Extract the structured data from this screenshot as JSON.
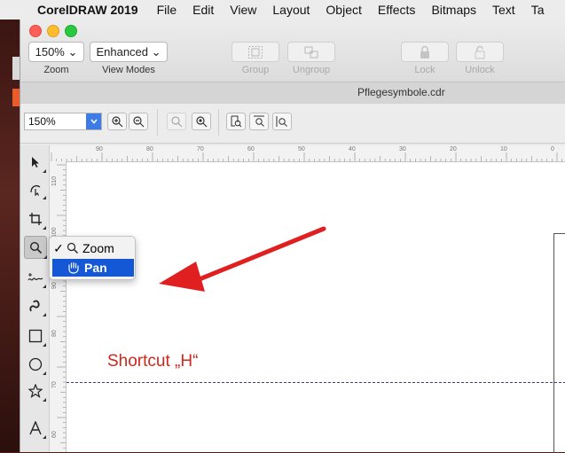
{
  "menubar": {
    "app_name": "CorelDRAW 2019",
    "items": [
      "File",
      "Edit",
      "View",
      "Layout",
      "Object",
      "Effects",
      "Bitmaps",
      "Text",
      "Ta"
    ]
  },
  "toolbar": {
    "zoom_value": "150% ⌄",
    "zoom_label": "Zoom",
    "view_mode_value": "Enhanced ⌄",
    "view_mode_label": "View Modes",
    "group_label": "Group",
    "ungroup_label": "Ungroup",
    "lock_label": "Lock",
    "unlock_label": "Unlock"
  },
  "document": {
    "filename": "Pflegesymbole.cdr"
  },
  "property_bar": {
    "zoom_level": "150%"
  },
  "ruler": {
    "horizontal_labels": [
      "90",
      "80",
      "70",
      "60",
      "50",
      "40",
      "30",
      "20",
      "10",
      "0"
    ],
    "vertical_labels": [
      "110",
      "100",
      "90",
      "80",
      "70",
      "60"
    ]
  },
  "zoom_menu": {
    "check_mark": "✓",
    "items": [
      "Zoom",
      "Pan"
    ],
    "checked_item": "Zoom",
    "highlighted_item": "Pan"
  },
  "annotation": {
    "text": "Shortcut „H“"
  },
  "colors": {
    "annotation_red": "#e02020",
    "selection_blue": "#1558d6",
    "close_light": "#fc5f57",
    "minimize_light": "#fdbc2e",
    "zoom_light": "#29c840"
  },
  "icons": {
    "toolbox": [
      "pick-tool-icon",
      "shape-tool-icon",
      "crop-tool-icon",
      "zoom-tool-icon",
      "freehand-tool-icon",
      "artistic-media-icon",
      "rectangle-tool-icon",
      "ellipse-tool-icon",
      "star-tool-icon",
      "text-tool-icon"
    ]
  }
}
